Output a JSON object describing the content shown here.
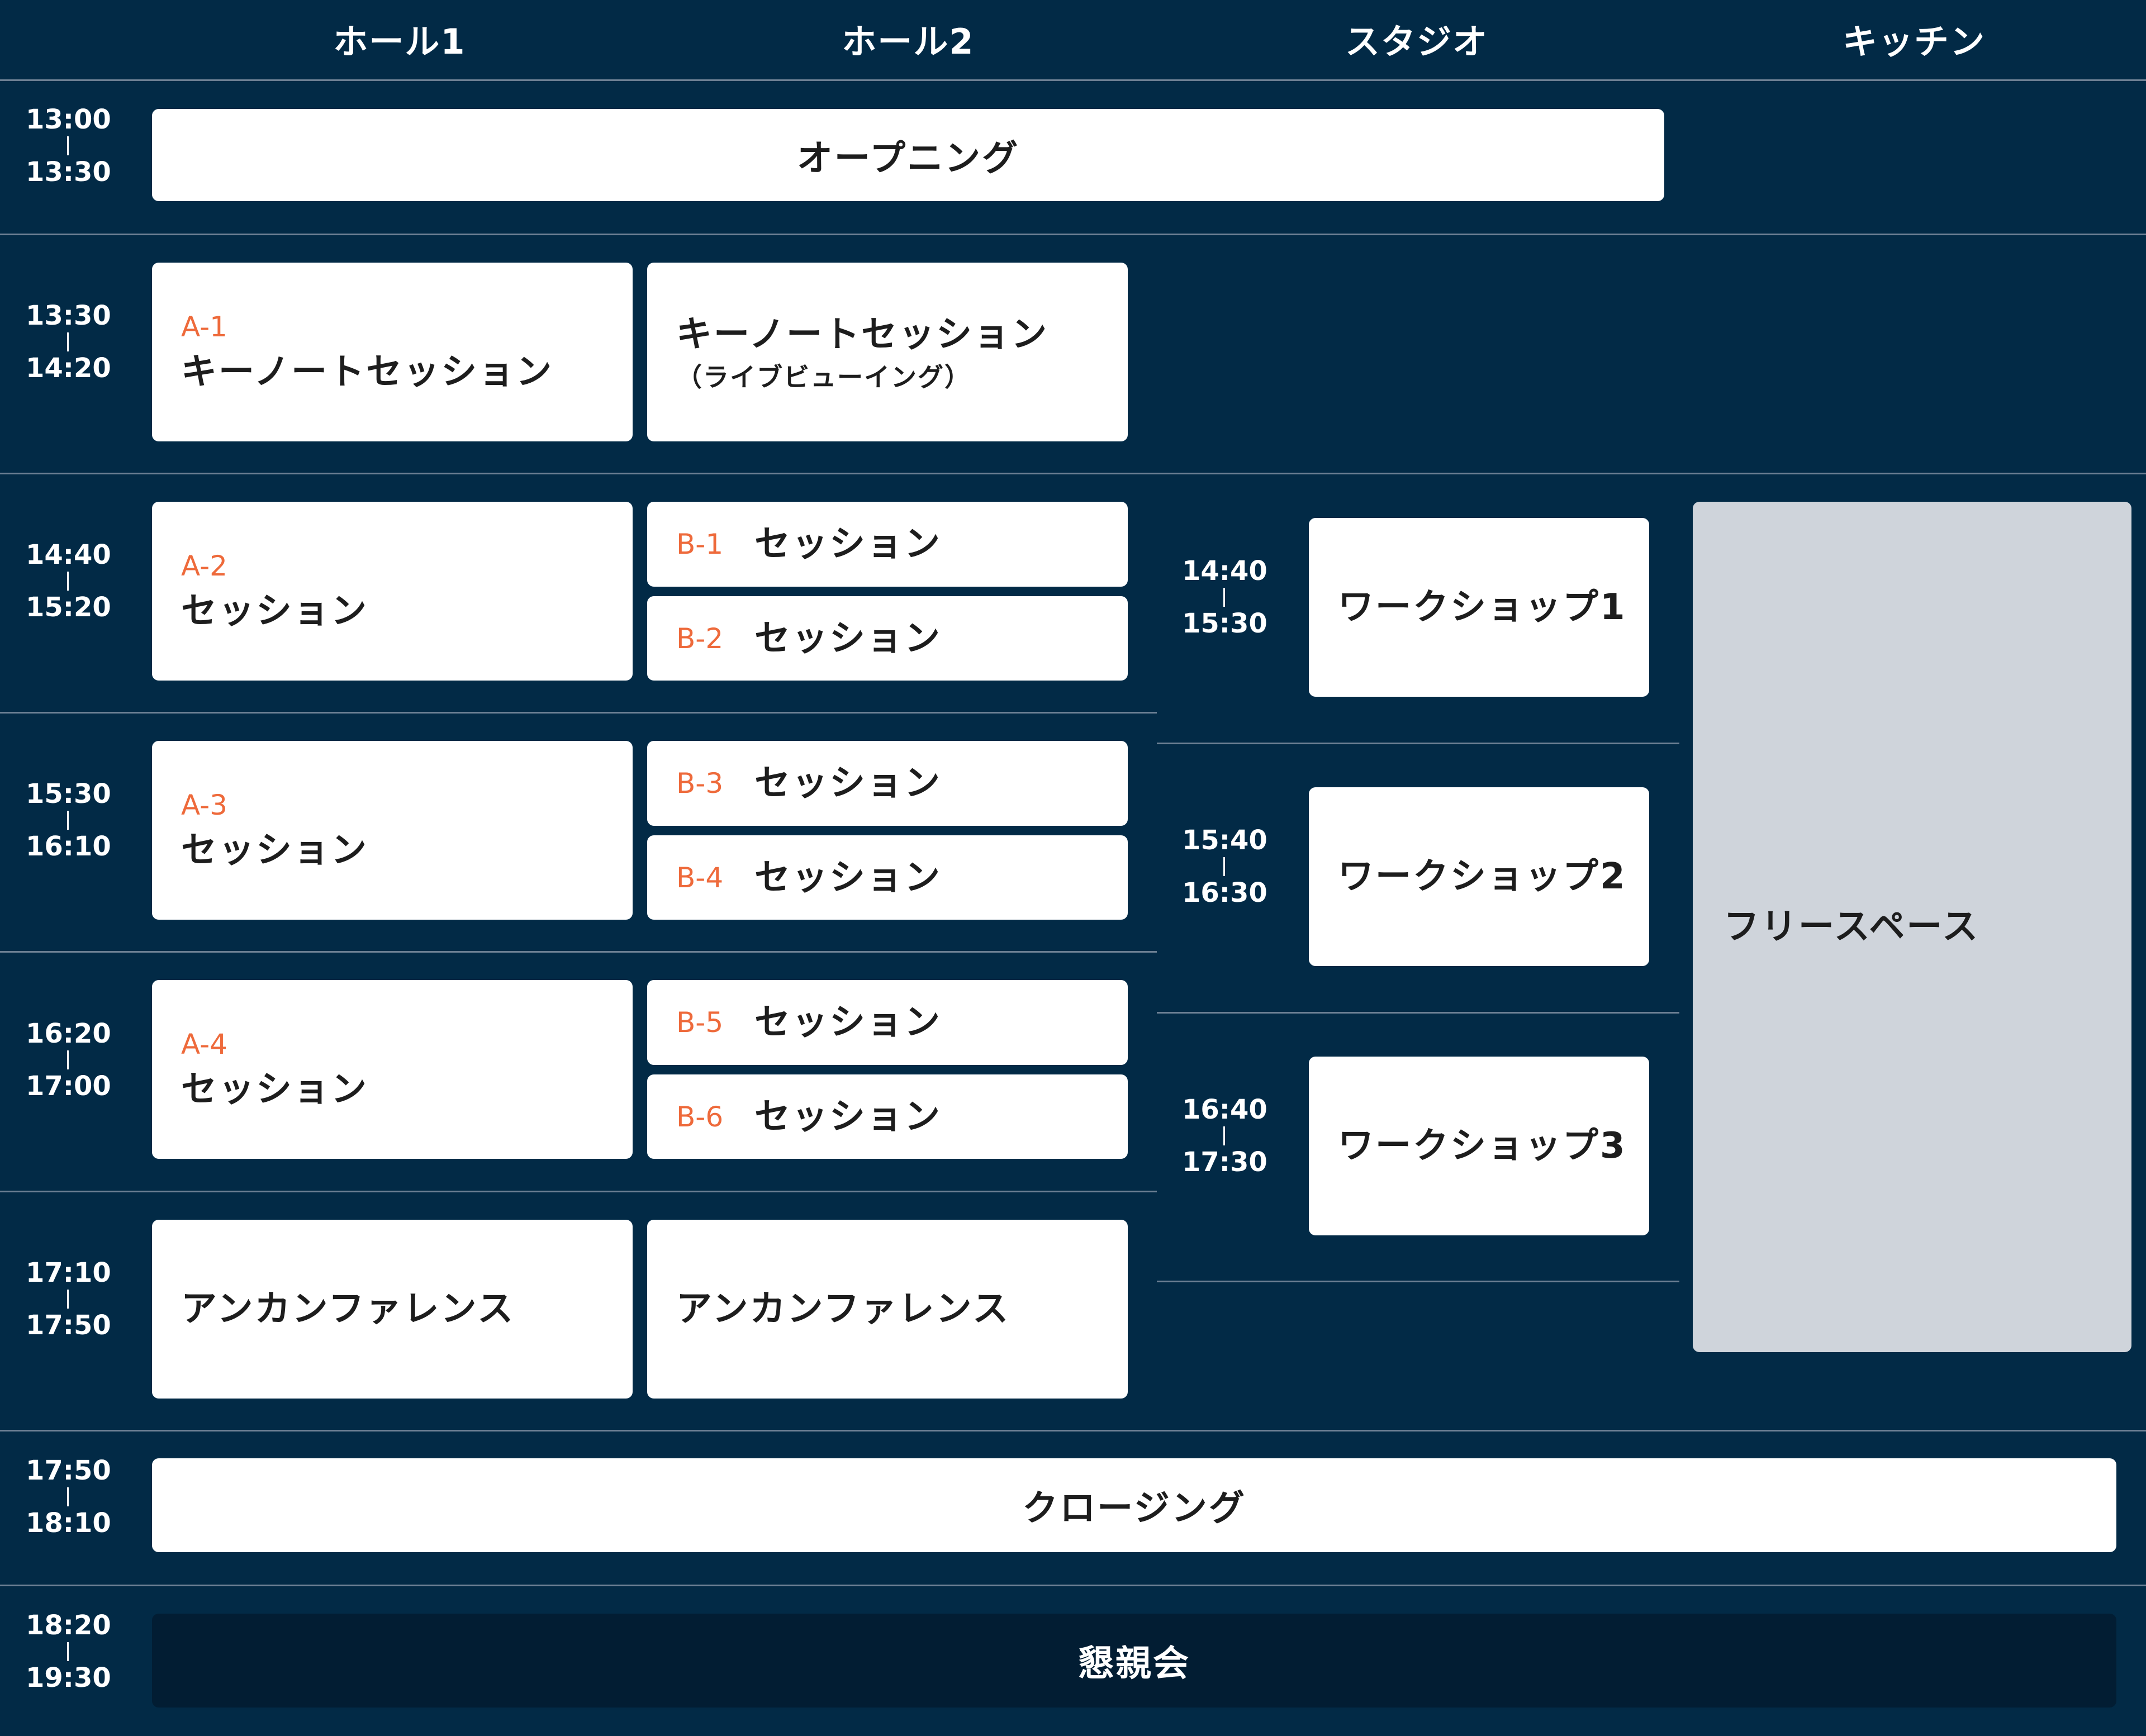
{
  "columns": {
    "hall1": "ホール1",
    "hall2": "ホール2",
    "studio": "スタジオ",
    "kitchen": "キッチン"
  },
  "times": {
    "opening": {
      "start": "13:00",
      "end": "13:30"
    },
    "keynote": {
      "start": "13:30",
      "end": "14:20"
    },
    "slot1": {
      "start": "14:40",
      "end": "15:20"
    },
    "slot2": {
      "start": "15:30",
      "end": "16:10"
    },
    "slot3": {
      "start": "16:20",
      "end": "17:00"
    },
    "slot4": {
      "start": "17:10",
      "end": "17:50"
    },
    "closing": {
      "start": "17:50",
      "end": "18:10"
    },
    "party": {
      "start": "18:20",
      "end": "19:30"
    },
    "ws1": {
      "start": "14:40",
      "end": "15:30"
    },
    "ws2": {
      "start": "15:40",
      "end": "16:30"
    },
    "ws3": {
      "start": "16:40",
      "end": "17:30"
    }
  },
  "events": {
    "opening": "オープニング",
    "keynote_hall1": {
      "code": "A-1",
      "title": "キーノートセッション"
    },
    "keynote_hall2": {
      "title": "キーノートセッション",
      "subtitle": "（ライブビューイング）"
    },
    "a2": {
      "code": "A-2",
      "title": "セッション"
    },
    "a3": {
      "code": "A-3",
      "title": "セッション"
    },
    "a4": {
      "code": "A-4",
      "title": "セッション"
    },
    "b1": {
      "code": "B-1",
      "title": "セッション"
    },
    "b2": {
      "code": "B-2",
      "title": "セッション"
    },
    "b3": {
      "code": "B-3",
      "title": "セッション"
    },
    "b4": {
      "code": "B-4",
      "title": "セッション"
    },
    "b5": {
      "code": "B-5",
      "title": "セッション"
    },
    "b6": {
      "code": "B-6",
      "title": "セッション"
    },
    "unconf_hall1": "アンカンファレンス",
    "unconf_hall2": "アンカンファレンス",
    "workshop1": "ワークショップ1",
    "workshop2": "ワークショップ2",
    "workshop3": "ワークショップ3",
    "free_space": "フリースペース",
    "closing": "クロージング",
    "party": "懇親会"
  },
  "colors": {
    "background": "#022a46",
    "card": "#ffffff",
    "code_accent": "#ee6a3b",
    "free_space": "#cfd4db",
    "party_card": "#021d33"
  }
}
